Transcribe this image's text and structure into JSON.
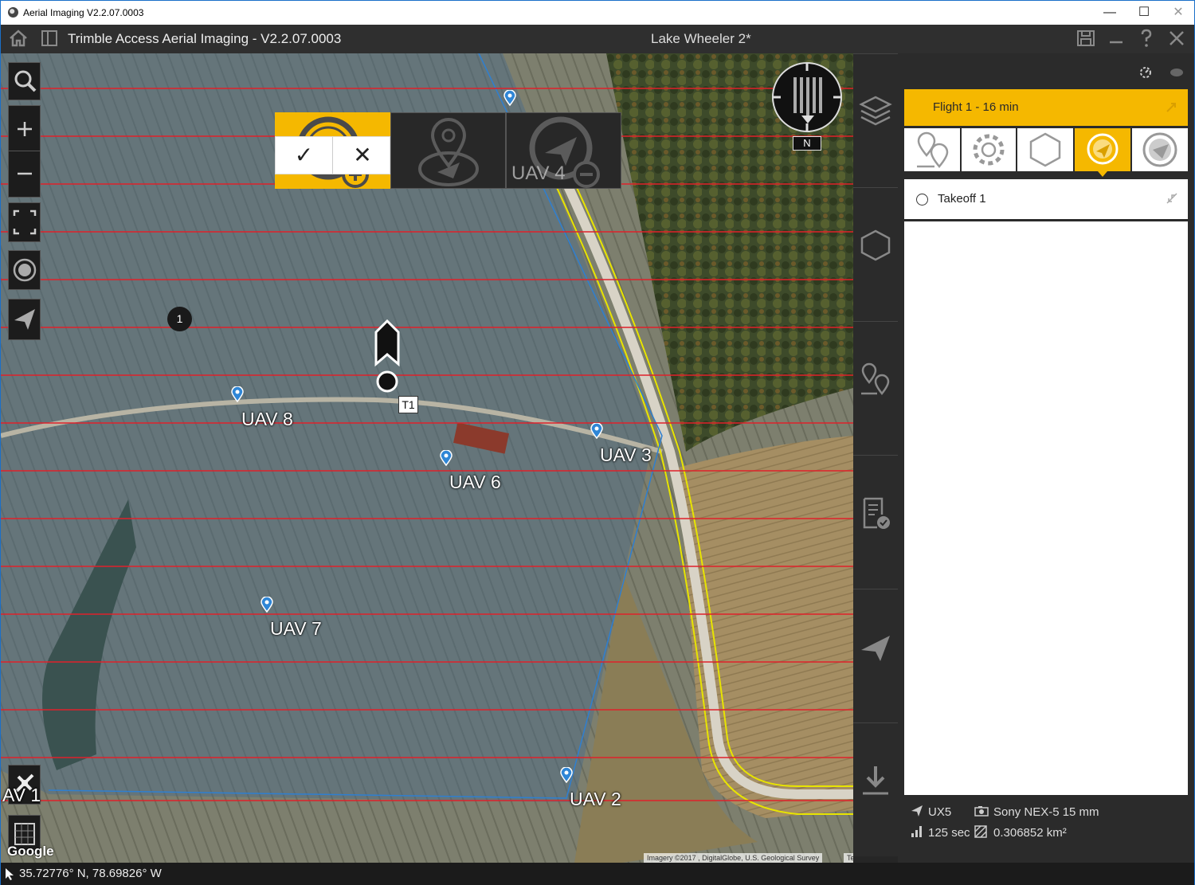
{
  "window": {
    "title": "Aerial Imaging V2.2.07.0003",
    "controls": [
      "—",
      "☐",
      "✕"
    ]
  },
  "appbar": {
    "title": "Trimble Access Aerial Imaging - V2.2.07.0003",
    "project": "Lake Wheeler 2*",
    "icons": [
      "home-icon",
      "panel-icon",
      "save-icon",
      "minimize-icon",
      "help-icon",
      "close-icon"
    ]
  },
  "map": {
    "labels": {
      "uav8": "UAV 8",
      "uav6": "UAV 6",
      "uav3": "UAV 3",
      "uav7": "UAV 7",
      "uav2": "UAV 2",
      "uav4": "UAV 4",
      "uav1": "AV 1"
    },
    "waypoint_badge": "1",
    "takeoff_tag": "T1",
    "compass_label": "N",
    "watermark": "Google",
    "attribution": "Imagery ©2017 , DigitalGlobe, U.S. Geological Survey",
    "terms": "Terms of Use",
    "accent_color": "#f5b800",
    "flight_line_color": "#e0212a"
  },
  "edit_toolbar": {
    "confirm": "✓",
    "cancel": "✕"
  },
  "panel": {
    "flight_title": "Flight 1 - 16 min",
    "list": [
      {
        "label": "Takeoff 1"
      }
    ],
    "footer": {
      "uav": "UX5",
      "camera": "Sony NEX-5 15 mm",
      "duration": "125 sec",
      "area": "0.306852 km²"
    }
  },
  "status": {
    "coords": "35.72776° N, 78.69826° W"
  }
}
